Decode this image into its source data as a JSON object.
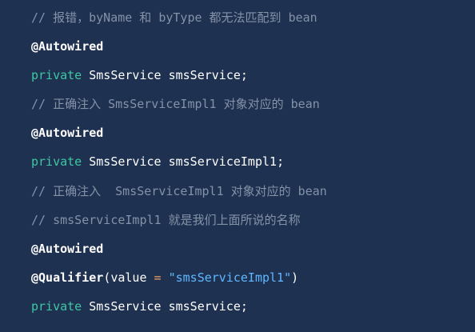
{
  "code": {
    "lines": [
      {
        "comment": "// 报错，byName 和 byType 都无法匹配到 bean"
      },
      {
        "annotation": "@Autowired"
      },
      {
        "keyword": "private",
        "type": "SmsService",
        "ident": "smsService",
        "punct": ";"
      },
      {
        "comment": "// 正确注入 SmsServiceImpl1 对象对应的 bean"
      },
      {
        "annotation": "@Autowired"
      },
      {
        "keyword": "private",
        "type": "SmsService",
        "ident": "smsServiceImpl1",
        "punct": ";"
      },
      {
        "comment": "// 正确注入  SmsServiceImpl1 对象对应的 bean"
      },
      {
        "comment": "// smsServiceImpl1 就是我们上面所说的名称"
      },
      {
        "annotation": "@Autowired"
      },
      {
        "annotation": "@Qualifier",
        "open": "(",
        "param": "value",
        "eq": "=",
        "string": "\"smsServiceImpl1\"",
        "close": ")"
      },
      {
        "keyword": "private",
        "type": "SmsService",
        "ident": "smsService",
        "punct": ";"
      }
    ]
  }
}
